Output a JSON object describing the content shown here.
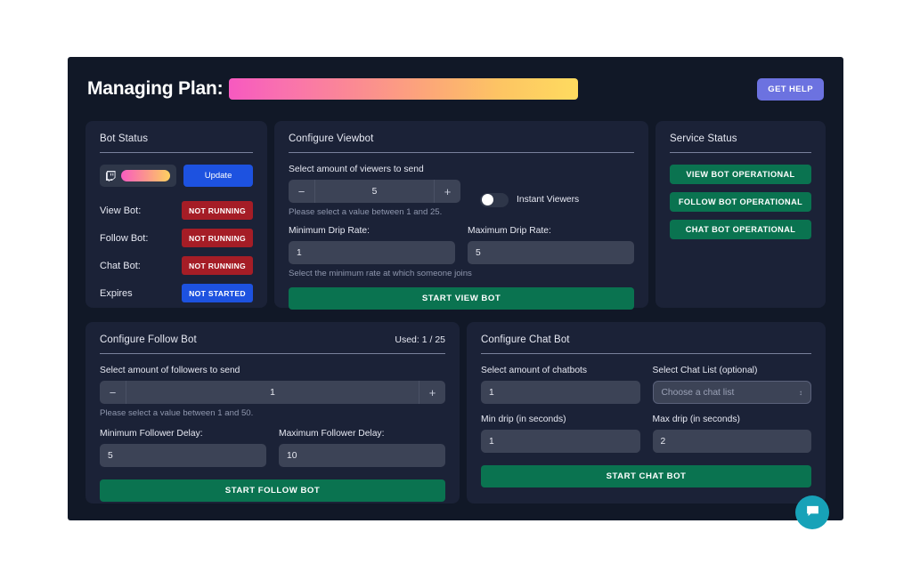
{
  "header": {
    "title": "Managing Plan:",
    "plan_bar_gradient": [
      "#f759c0",
      "#fedb5f"
    ],
    "help_label": "GET HELP",
    "help_color": "#6c72e0"
  },
  "bot_status": {
    "title": "Bot Status",
    "account": {
      "platform_icon": "twitch-icon",
      "name_hidden": true
    },
    "update_label": "Update",
    "update_color": "#1d52e0",
    "rows": [
      {
        "label": "View Bot:",
        "value": "NOT RUNNING",
        "color": "#a51d26"
      },
      {
        "label": "Follow Bot:",
        "value": "NOT RUNNING",
        "color": "#a51d26"
      },
      {
        "label": "Chat Bot:",
        "value": "NOT RUNNING",
        "color": "#a51d26"
      },
      {
        "label": "Expires",
        "value": "NOT STARTED",
        "color": "#1d52e0"
      }
    ]
  },
  "viewbot": {
    "title": "Configure Viewbot",
    "amount_label": "Select amount of viewers to send",
    "amount_value": "5",
    "minus_label": "−",
    "plus_label": "+",
    "amount_hint": "Please select a value between 1 and 25.",
    "toggle_label": "Instant Viewers",
    "toggle_on": false,
    "min_drip_label": "Minimum Drip Rate:",
    "min_drip_value": "1",
    "max_drip_label": "Maximum Drip Rate:",
    "max_drip_value": "5",
    "drip_hint": "Select the minimum rate at which someone joins",
    "start_label": "START VIEW BOT",
    "start_color": "#0a7350"
  },
  "service_status": {
    "title": "Service Status",
    "items": [
      {
        "label": "VIEW BOT OPERATIONAL",
        "color": "#0a7350"
      },
      {
        "label": "FOLLOW BOT OPERATIONAL",
        "color": "#0a7350"
      },
      {
        "label": "CHAT BOT OPERATIONAL",
        "color": "#0a7350"
      }
    ]
  },
  "followbot": {
    "title": "Configure Follow Bot",
    "used_label": "Used: 1 / 25",
    "amount_label": "Select amount of followers to send",
    "amount_value": "1",
    "minus_label": "−",
    "plus_label": "+",
    "amount_hint": "Please select a value between 1 and 50.",
    "min_delay_label": "Minimum Follower Delay:",
    "min_delay_value": "5",
    "max_delay_label": "Maximum Follower Delay:",
    "max_delay_value": "10",
    "start_label": "START FOLLOW BOT",
    "start_color": "#0a7350"
  },
  "chatbot": {
    "title": "Configure Chat Bot",
    "amount_label": "Select amount of chatbots",
    "amount_value": "1",
    "chatlist_label": "Select Chat List (optional)",
    "chatlist_placeholder": "Choose a chat list",
    "chatlist_value": "",
    "min_drip_label": "Min drip (in seconds)",
    "min_drip_value": "1",
    "max_drip_label": "Max drip (in seconds)",
    "max_drip_value": "2",
    "start_label": "START CHAT BOT",
    "start_color": "#0a7350"
  },
  "chat_widget": {
    "icon": "chat-bubble-icon",
    "color": "#17a2b8"
  }
}
